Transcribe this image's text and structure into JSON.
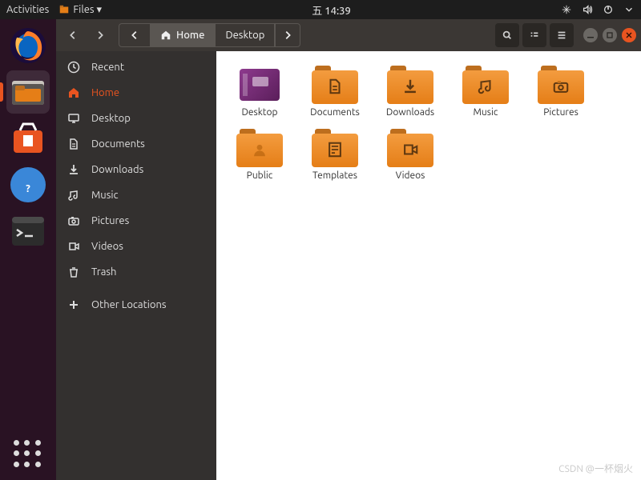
{
  "topbar": {
    "activities": "Activities",
    "files_menu": "Files ▾",
    "clock": "五 14:39"
  },
  "breadcrumbs": {
    "home": "Home",
    "child": "Desktop"
  },
  "sidebar": [
    {
      "id": "recent",
      "label": "Recent",
      "icon": "clock"
    },
    {
      "id": "home",
      "label": "Home",
      "icon": "home",
      "active": true
    },
    {
      "id": "desktop",
      "label": "Desktop",
      "icon": "desktop"
    },
    {
      "id": "documents",
      "label": "Documents",
      "icon": "doc"
    },
    {
      "id": "downloads",
      "label": "Downloads",
      "icon": "down"
    },
    {
      "id": "music",
      "label": "Music",
      "icon": "music"
    },
    {
      "id": "pictures",
      "label": "Pictures",
      "icon": "camera"
    },
    {
      "id": "videos",
      "label": "Videos",
      "icon": "video"
    },
    {
      "id": "trash",
      "label": "Trash",
      "icon": "trash"
    },
    {
      "id": "other",
      "label": "Other Locations",
      "icon": "plus"
    }
  ],
  "files": [
    {
      "name": "Desktop",
      "icon": "desktop-purple"
    },
    {
      "name": "Documents",
      "icon": "doc"
    },
    {
      "name": "Downloads",
      "icon": "down"
    },
    {
      "name": "Music",
      "icon": "music"
    },
    {
      "name": "Pictures",
      "icon": "camera"
    },
    {
      "name": "Public",
      "icon": "public"
    },
    {
      "name": "Templates",
      "icon": "template"
    },
    {
      "name": "Videos",
      "icon": "video"
    }
  ],
  "watermark": "CSDN @一杯烟火"
}
